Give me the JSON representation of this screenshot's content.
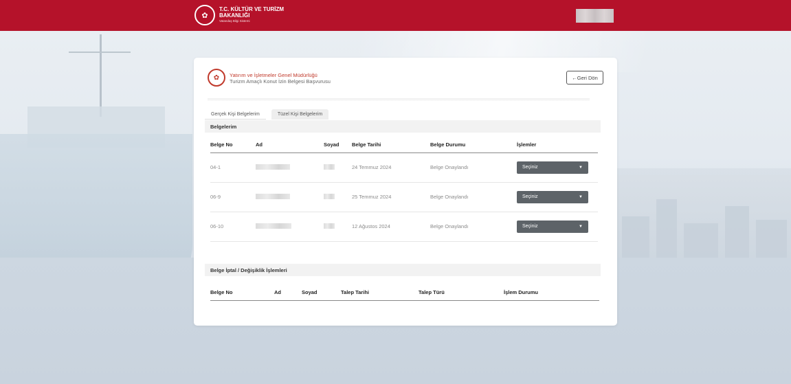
{
  "header": {
    "org_line1": "T.C. KÜLTÜR VE TURİZM",
    "org_line2": "BAKANLIĞI",
    "org_line3": "Vatandaş Bilgi Sistemi",
    "logo_icon": "ministry-seal-icon"
  },
  "card": {
    "title": "Yatırım ve İşletmeler Genel Müdürlüğü",
    "subtitle": "Turizm Amaçlı Konut İzin Belgesi Başvurusu",
    "back_label": "←Geri Dön"
  },
  "tabs": [
    {
      "label": "Gerçek Kişi Belgelerim",
      "active": true
    },
    {
      "label": "Tüzel Kişi Belgelerim",
      "active": false
    }
  ],
  "documents": {
    "section_title": "Belgelerim",
    "columns": [
      "Belge No",
      "Ad",
      "Soyad",
      "Belge Tarihi",
      "Belge Durumu",
      "İşlemler"
    ],
    "rows": [
      {
        "no": "04-1",
        "date": "24 Temmuz 2024",
        "status": "Belge Onaylandı",
        "action": "Seçiniz"
      },
      {
        "no": "06-9",
        "date": "25 Temmuz 2024",
        "status": "Belge Onaylandı",
        "action": "Seçiniz"
      },
      {
        "no": "06-10",
        "date": "12 Ağustos 2024",
        "status": "Belge Onaylandı",
        "action": "Seçiniz"
      }
    ]
  },
  "cancellations": {
    "section_title": "Belge İptal / Değişiklik İşlemleri",
    "columns": [
      "Belge No",
      "Ad",
      "Soyad",
      "Talep Tarihi",
      "Talep Türü",
      "İşlem Durumu"
    ]
  },
  "colors": {
    "brand_red": "#b5122a",
    "button_gray": "#5d6368"
  }
}
